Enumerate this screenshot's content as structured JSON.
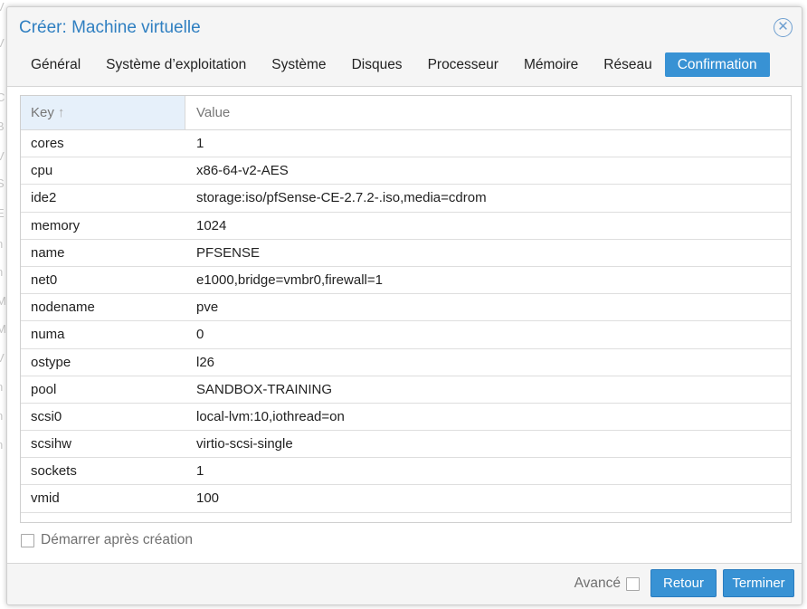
{
  "dialog": {
    "title": "Créer: Machine virtuelle",
    "close_icon": "close-icon",
    "accent_color": "#3892d4"
  },
  "tabs": [
    {
      "label": "Général",
      "active": false
    },
    {
      "label": "Système d’exploitation",
      "active": false
    },
    {
      "label": "Système",
      "active": false
    },
    {
      "label": "Disques",
      "active": false
    },
    {
      "label": "Processeur",
      "active": false
    },
    {
      "label": "Mémoire",
      "active": false
    },
    {
      "label": "Réseau",
      "active": false
    },
    {
      "label": "Confirmation",
      "active": true
    }
  ],
  "grid": {
    "columns": {
      "key": "Key",
      "value": "Value"
    },
    "sort_icon": "arrow-up-icon",
    "rows": [
      {
        "key": "cores",
        "value": "1"
      },
      {
        "key": "cpu",
        "value": "x86-64-v2-AES"
      },
      {
        "key": "ide2",
        "value": "storage:iso/pfSense-CE-2.7.2-.iso,media=cdrom"
      },
      {
        "key": "memory",
        "value": "1024"
      },
      {
        "key": "name",
        "value": "PFSENSE"
      },
      {
        "key": "net0",
        "value": "e1000,bridge=vmbr0,firewall=1"
      },
      {
        "key": "nodename",
        "value": "pve"
      },
      {
        "key": "numa",
        "value": "0"
      },
      {
        "key": "ostype",
        "value": "l26"
      },
      {
        "key": "pool",
        "value": "SANDBOX-TRAINING"
      },
      {
        "key": "scsi0",
        "value": "local-lvm:10,iothread=on"
      },
      {
        "key": "scsihw",
        "value": "virtio-scsi-single"
      },
      {
        "key": "sockets",
        "value": "1"
      },
      {
        "key": "vmid",
        "value": "100"
      }
    ]
  },
  "start_after_create": {
    "label": "Démarrer après création",
    "checked": false
  },
  "footer": {
    "advanced_label": "Avancé",
    "advanced_checked": false,
    "back_label": "Retour",
    "finish_label": "Terminer"
  }
}
